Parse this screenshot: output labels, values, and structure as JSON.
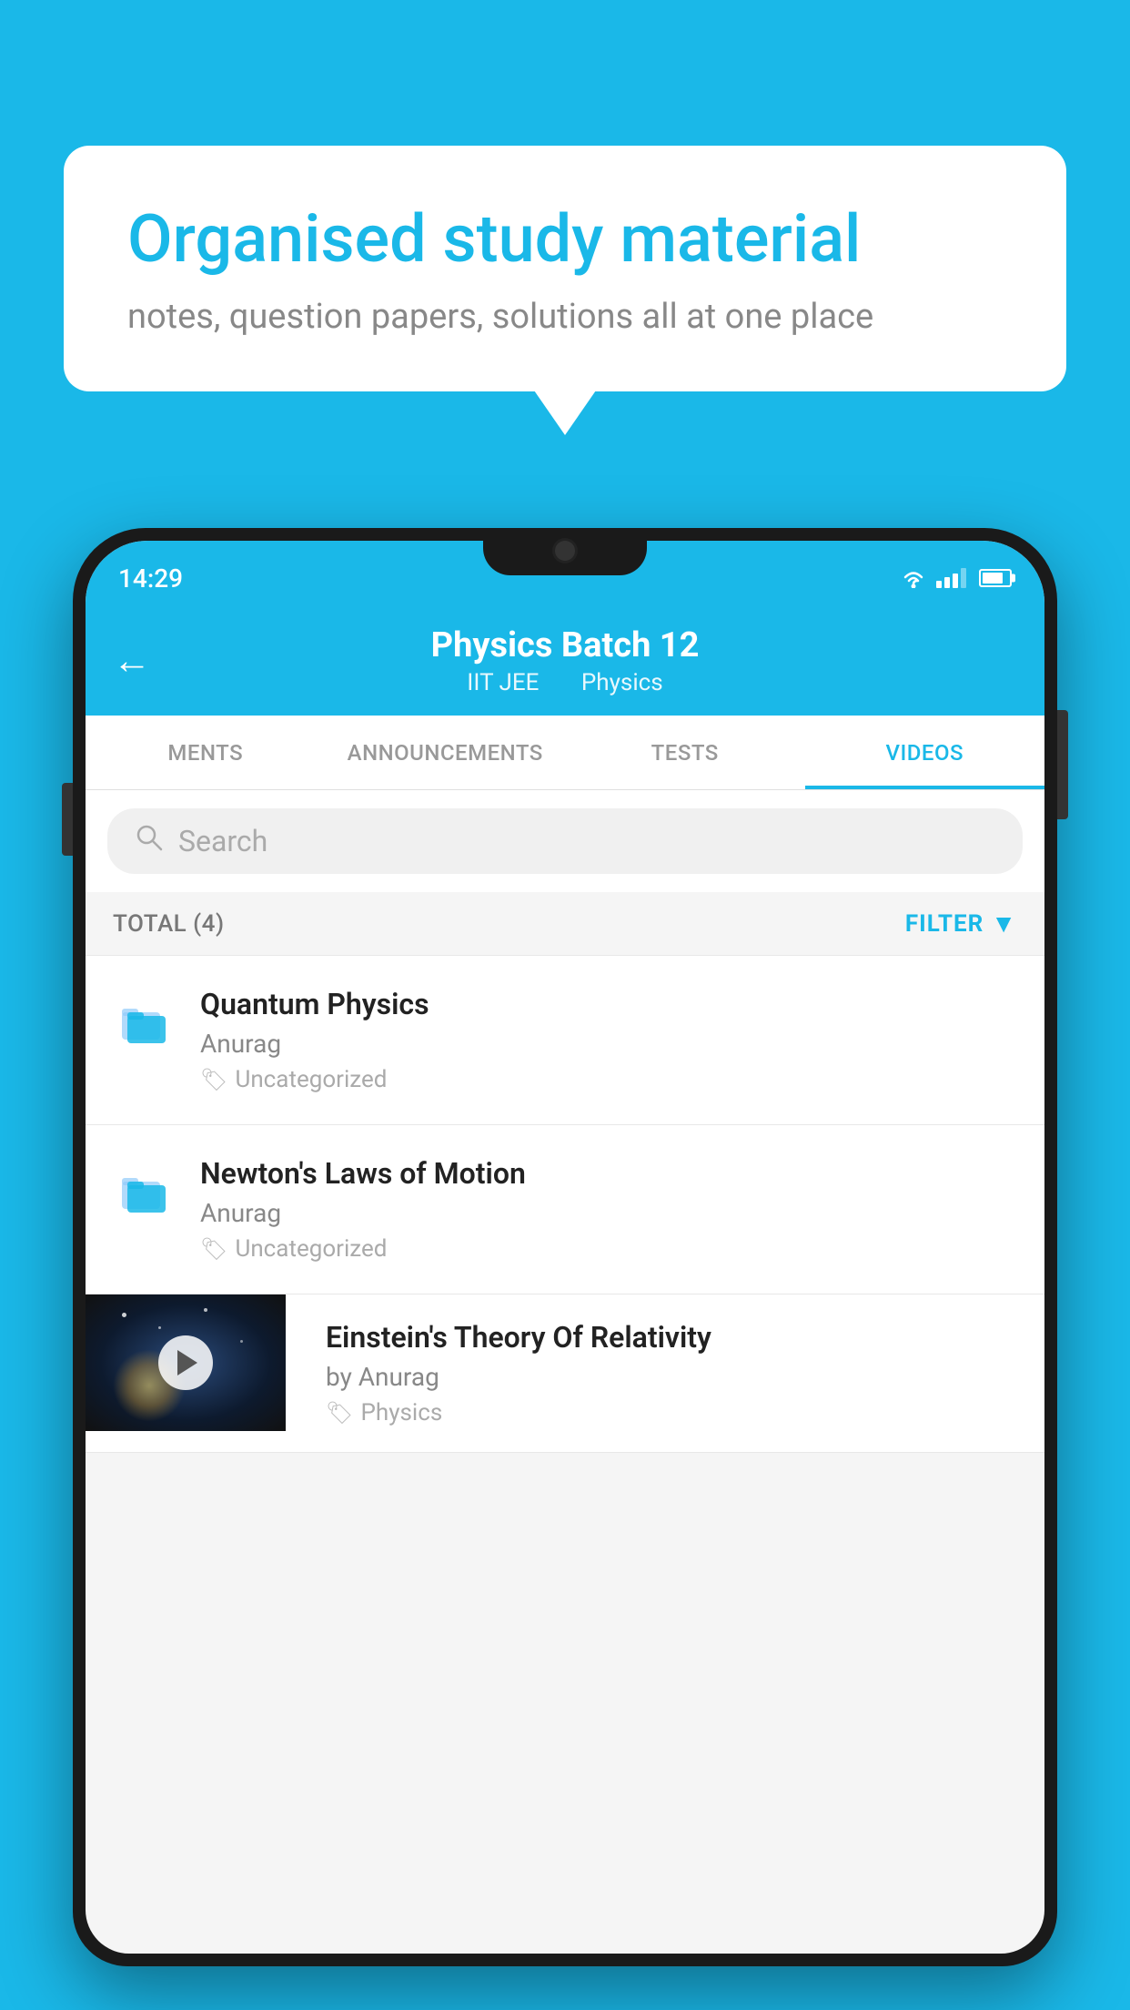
{
  "background": {
    "color": "#1ab8e8"
  },
  "speech_bubble": {
    "title": "Organised study material",
    "subtitle": "notes, question papers, solutions all at one place"
  },
  "status_bar": {
    "time": "14:29"
  },
  "app_header": {
    "title": "Physics Batch 12",
    "subtitle_part1": "IIT JEE",
    "subtitle_part2": "Physics",
    "back_label": "←"
  },
  "tabs": [
    {
      "label": "MENTS",
      "active": false
    },
    {
      "label": "ANNOUNCEMENTS",
      "active": false
    },
    {
      "label": "TESTS",
      "active": false
    },
    {
      "label": "VIDEOS",
      "active": true
    }
  ],
  "search": {
    "placeholder": "Search"
  },
  "filter_bar": {
    "total_label": "TOTAL (4)",
    "filter_label": "FILTER"
  },
  "videos": [
    {
      "id": 1,
      "title": "Quantum Physics",
      "author": "Anurag",
      "tag": "Uncategorized",
      "has_thumb": false
    },
    {
      "id": 2,
      "title": "Newton's Laws of Motion",
      "author": "Anurag",
      "tag": "Uncategorized",
      "has_thumb": false
    },
    {
      "id": 3,
      "title": "Einstein's Theory Of Relativity",
      "author": "by Anurag",
      "tag": "Physics",
      "has_thumb": true
    }
  ]
}
